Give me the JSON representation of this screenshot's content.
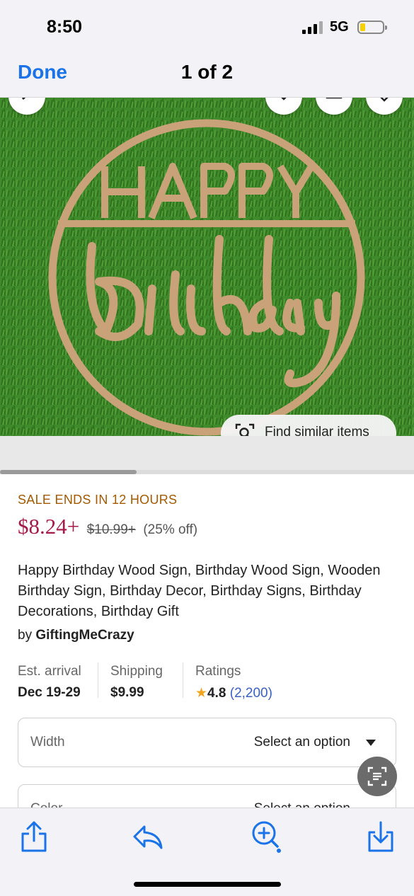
{
  "status_bar": {
    "time": "8:50",
    "network": "5G"
  },
  "nav": {
    "done_label": "Done",
    "title": "1 of 2"
  },
  "image": {
    "find_similar_label": "Find similar items"
  },
  "carousel": {
    "position_fraction": 0.33
  },
  "listing": {
    "sale_banner": "SALE ENDS IN 12 HOURS",
    "price": "$8.24+",
    "original_price": "$10.99+",
    "discount": "(25% off)",
    "title": "Happy Birthday Wood Sign, Birthday Wood Sign, Wooden Birthday Sign, Birthday Decor, Birthday Signs, Birthday Decorations,  Birthday Gift",
    "by_prefix": "by",
    "shop_name": "GiftingMeCrazy"
  },
  "meta": {
    "arrival_label": "Est. arrival",
    "arrival_value": "Dec 19-29",
    "shipping_label": "Shipping",
    "shipping_value": "$9.99",
    "ratings_label": "Ratings",
    "rating_value": "4.8",
    "rating_count": "(2,200)"
  },
  "options": [
    {
      "label": "Width",
      "value": "Select an option"
    },
    {
      "label": "Color",
      "value": "Select an option"
    }
  ],
  "colors": {
    "accent_blue": "#1a73e8",
    "sale_orange": "#a35a00",
    "price_red": "#a61a4a",
    "star_gold": "#f2a51a",
    "rating_link": "#3960c4"
  },
  "icons": {
    "toolbar": [
      "share-icon",
      "markup-icon",
      "visual-lookup-icon",
      "save-icon"
    ],
    "image_actions": [
      "back-icon",
      "message-icon",
      "share-icon",
      "favorite-icon"
    ]
  }
}
